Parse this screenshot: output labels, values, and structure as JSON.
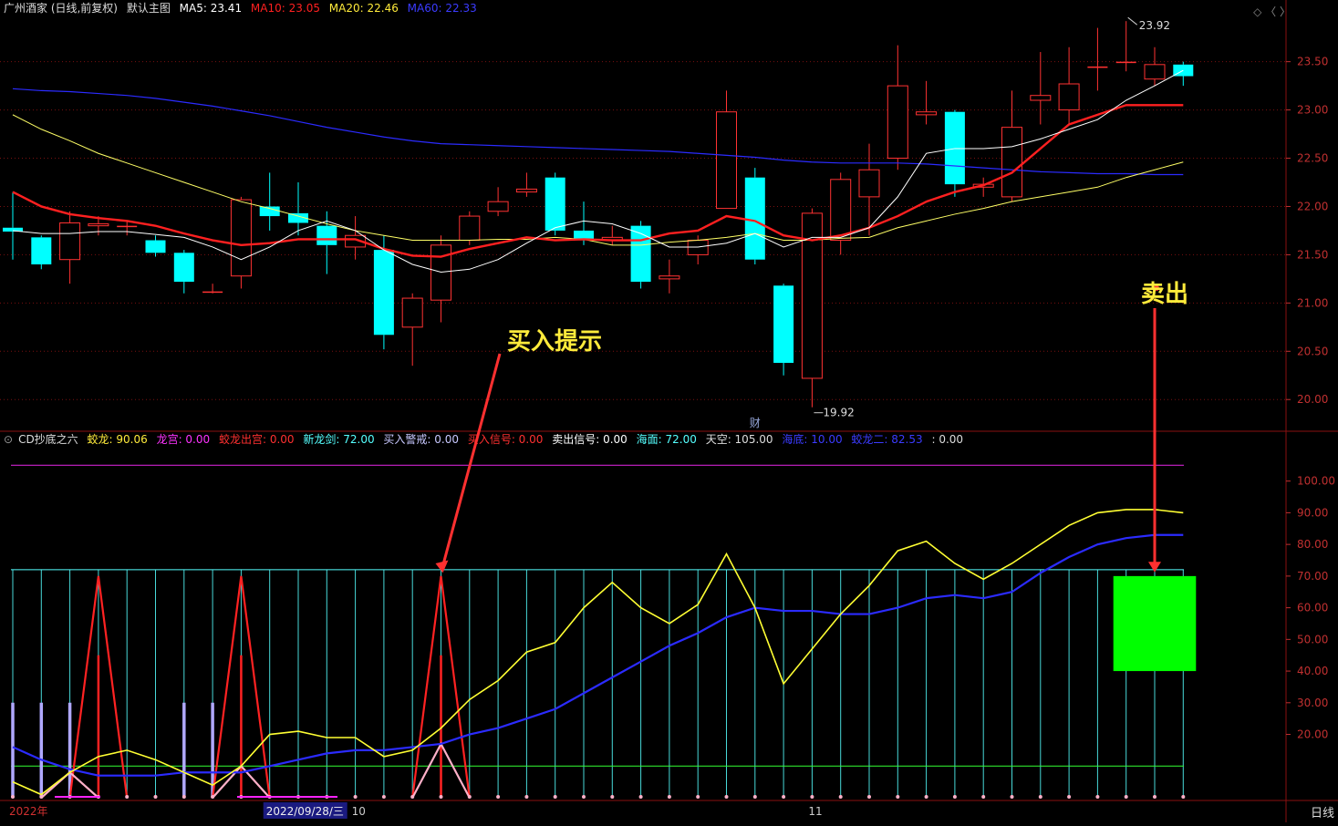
{
  "header": {
    "stock": "广州酒家 (日线,前复权)",
    "chart_name": "默认主图",
    "ma": [
      {
        "label": "MA5: 23.41",
        "color": "#ffffff"
      },
      {
        "label": "MA10: 23.05",
        "color": "#ff2020"
      },
      {
        "label": "MA20: 22.46",
        "color": "#ffeb3b"
      },
      {
        "label": "MA60: 22.33",
        "color": "#3b3bff"
      }
    ]
  },
  "indicator_header": {
    "name": "CD抄底之六",
    "items": [
      {
        "label": "蛟龙: 90.06",
        "color": "#ffeb3b"
      },
      {
        "label": "龙宫: 0.00",
        "color": "#ff33ff"
      },
      {
        "label": "蛟龙出宫: 0.00",
        "color": "#ff3030"
      },
      {
        "label": "新龙剑: 72.00",
        "color": "#55ffff"
      },
      {
        "label": "买入警戒: 0.00",
        "color": "#c8c8ff"
      },
      {
        "label": "买入信号: 0.00",
        "color": "#ff3030"
      },
      {
        "label": "卖出信号: 0.00",
        "color": "#ffffff"
      },
      {
        "label": "海面: 72.00",
        "color": "#55ffff"
      },
      {
        "label": "天空: 105.00",
        "color": "#dddddd"
      },
      {
        "label": "海底: 10.00",
        "color": "#3b3bff"
      },
      {
        "label": "蛟龙二: 82.53",
        "color": "#3b3bff"
      },
      {
        "label": ": 0.00",
        "color": "#dddddd"
      }
    ]
  },
  "annotations": {
    "buy": "买入提示",
    "sell": "卖出",
    "fin_marker": "财"
  },
  "timeframe": "日线",
  "colors": {
    "up": "#ff3232",
    "down": "#00ffff",
    "ma5": "#ffffff",
    "ma10": "#ff2020",
    "ma20": "#ffff66",
    "ma60": "#2b2bff",
    "grid": "#7a1010",
    "axis_text": "#c03030"
  },
  "chart_data": [
    {
      "type": "candlestick",
      "ylim": [
        19.7,
        23.95
      ],
      "yticks": [
        20.0,
        20.5,
        21.0,
        21.5,
        22.0,
        22.5,
        23.0,
        23.5
      ],
      "high_label": "23.92",
      "low_label": "19.92",
      "candles": [
        {
          "o": 21.78,
          "c": 21.74,
          "h": 22.15,
          "l": 21.45
        },
        {
          "o": 21.68,
          "c": 21.4,
          "h": 21.7,
          "l": 21.35
        },
        {
          "o": 21.45,
          "c": 21.83,
          "h": 21.95,
          "l": 21.2
        },
        {
          "o": 21.8,
          "c": 21.82,
          "h": 21.9,
          "l": 21.7
        },
        {
          "o": 21.8,
          "c": 21.8,
          "h": 21.85,
          "l": 21.7
        },
        {
          "o": 21.65,
          "c": 21.52,
          "h": 21.7,
          "l": 21.48
        },
        {
          "o": 21.52,
          "c": 21.22,
          "h": 21.55,
          "l": 21.1
        },
        {
          "o": 21.12,
          "c": 21.12,
          "h": 21.2,
          "l": 21.1
        },
        {
          "o": 21.28,
          "c": 22.07,
          "h": 22.1,
          "l": 21.15
        },
        {
          "o": 22.0,
          "c": 21.9,
          "h": 22.35,
          "l": 21.75
        },
        {
          "o": 21.93,
          "c": 21.83,
          "h": 22.25,
          "l": 21.7
        },
        {
          "o": 21.8,
          "c": 21.6,
          "h": 21.95,
          "l": 21.3
        },
        {
          "o": 21.58,
          "c": 21.7,
          "h": 21.9,
          "l": 21.45
        },
        {
          "o": 21.55,
          "c": 20.67,
          "h": 21.7,
          "l": 20.52
        },
        {
          "o": 20.75,
          "c": 21.05,
          "h": 21.1,
          "l": 20.35
        },
        {
          "o": 21.03,
          "c": 21.6,
          "h": 21.7,
          "l": 20.8
        },
        {
          "o": 21.65,
          "c": 21.9,
          "h": 21.95,
          "l": 21.6
        },
        {
          "o": 21.95,
          "c": 22.05,
          "h": 22.2,
          "l": 21.9
        },
        {
          "o": 22.15,
          "c": 22.18,
          "h": 22.35,
          "l": 22.1
        },
        {
          "o": 22.3,
          "c": 21.75,
          "h": 22.35,
          "l": 21.7
        },
        {
          "o": 21.75,
          "c": 21.65,
          "h": 22.05,
          "l": 21.6
        },
        {
          "o": 21.65,
          "c": 21.68,
          "h": 21.8,
          "l": 21.6
        },
        {
          "o": 21.8,
          "c": 21.22,
          "h": 21.85,
          "l": 21.15
        },
        {
          "o": 21.25,
          "c": 21.28,
          "h": 21.45,
          "l": 21.1
        },
        {
          "o": 21.5,
          "c": 21.65,
          "h": 21.7,
          "l": 21.4
        },
        {
          "o": 21.98,
          "c": 22.98,
          "h": 23.2,
          "l": 21.98
        },
        {
          "o": 22.3,
          "c": 21.45,
          "h": 22.4,
          "l": 21.4
        },
        {
          "o": 21.18,
          "c": 20.38,
          "h": 21.2,
          "l": 20.25
        },
        {
          "o": 20.22,
          "c": 21.93,
          "h": 21.98,
          "l": 19.92
        },
        {
          "o": 21.65,
          "c": 22.28,
          "h": 22.35,
          "l": 21.5
        },
        {
          "o": 22.1,
          "c": 22.38,
          "h": 22.65,
          "l": 21.7
        },
        {
          "o": 22.5,
          "c": 23.25,
          "h": 23.67,
          "l": 22.38
        },
        {
          "o": 22.95,
          "c": 22.98,
          "h": 23.3,
          "l": 22.85
        },
        {
          "o": 22.98,
          "c": 22.23,
          "h": 23.0,
          "l": 22.1
        },
        {
          "o": 22.2,
          "c": 22.23,
          "h": 22.3,
          "l": 22.1
        },
        {
          "o": 22.1,
          "c": 22.82,
          "h": 23.2,
          "l": 22.05
        },
        {
          "o": 23.1,
          "c": 23.15,
          "h": 23.6,
          "l": 22.85
        },
        {
          "o": 23.0,
          "c": 23.27,
          "h": 23.65,
          "l": 22.85
        },
        {
          "o": 23.45,
          "c": 23.45,
          "h": 23.85,
          "l": 23.2
        },
        {
          "o": 23.5,
          "c": 23.5,
          "h": 23.92,
          "l": 23.4
        },
        {
          "o": 23.32,
          "c": 23.47,
          "h": 23.65,
          "l": 23.25
        },
        {
          "o": 23.47,
          "c": 23.35,
          "h": 23.5,
          "l": 23.25
        }
      ],
      "ma5": [
        21.75,
        21.72,
        21.72,
        21.74,
        21.74,
        21.71,
        21.68,
        21.58,
        21.45,
        21.58,
        21.75,
        21.85,
        21.75,
        21.55,
        21.4,
        21.32,
        21.35,
        21.45,
        21.62,
        21.78,
        21.85,
        21.82,
        21.72,
        21.58,
        21.58,
        21.62,
        21.72,
        21.58,
        21.68,
        21.68,
        21.78,
        22.1,
        22.55,
        22.6,
        22.6,
        22.62,
        22.7,
        22.8,
        22.9,
        23.1,
        23.25,
        23.41
      ],
      "ma10": [
        22.15,
        22.0,
        21.92,
        21.88,
        21.85,
        21.8,
        21.72,
        21.65,
        21.6,
        21.62,
        21.66,
        21.66,
        21.66,
        21.56,
        21.49,
        21.48,
        21.56,
        21.62,
        21.68,
        21.65,
        21.66,
        21.65,
        21.65,
        21.72,
        21.75,
        21.9,
        21.85,
        21.7,
        21.65,
        21.7,
        21.78,
        21.9,
        22.05,
        22.15,
        22.22,
        22.35,
        22.6,
        22.85,
        22.95,
        23.05,
        23.05,
        23.05
      ],
      "ma20": [
        22.95,
        22.8,
        22.68,
        22.55,
        22.45,
        22.35,
        22.25,
        22.15,
        22.05,
        21.98,
        21.9,
        21.82,
        21.75,
        21.7,
        21.65,
        21.65,
        21.65,
        21.66,
        21.66,
        21.68,
        21.66,
        21.6,
        21.6,
        21.63,
        21.65,
        21.68,
        21.72,
        21.65,
        21.65,
        21.67,
        21.68,
        21.78,
        21.85,
        21.92,
        21.98,
        22.05,
        22.1,
        22.15,
        22.2,
        22.3,
        22.38,
        22.46
      ],
      "ma60": [
        23.22,
        23.2,
        23.19,
        23.17,
        23.15,
        23.12,
        23.08,
        23.04,
        22.99,
        22.94,
        22.88,
        22.82,
        22.77,
        22.72,
        22.68,
        22.65,
        22.64,
        22.63,
        22.62,
        22.61,
        22.6,
        22.59,
        22.58,
        22.57,
        22.55,
        22.53,
        22.51,
        22.48,
        22.46,
        22.45,
        22.45,
        22.45,
        22.44,
        22.42,
        22.4,
        22.38,
        22.36,
        22.35,
        22.34,
        22.34,
        22.33,
        22.33
      ]
    },
    {
      "type": "line",
      "title": "CD抄底之六",
      "ylim": [
        0,
        112
      ],
      "yticks": [
        20,
        30,
        40,
        50,
        60,
        70,
        80,
        90,
        100
      ],
      "tick_labels": [
        "20.00",
        "30.00",
        "40.00",
        "50.00",
        "60.00",
        "70.00",
        "80.00",
        "90.00",
        "100.00"
      ],
      "x_labels": [
        {
          "label": "2022年",
          "index": 0
        },
        {
          "label": "2022/09/28/三",
          "index": 9
        },
        {
          "label": "10",
          "index": 12
        },
        {
          "label": "11",
          "index": 28
        }
      ],
      "series": [
        {
          "name": "蛟龙",
          "color": "#ffff33",
          "values": [
            5,
            1,
            8,
            13,
            15,
            12,
            8,
            4,
            10,
            20,
            21,
            19,
            19,
            13,
            15,
            22,
            31,
            37,
            46,
            49,
            60,
            68,
            60,
            55,
            61,
            77,
            60,
            36,
            47,
            58,
            67,
            78,
            81,
            74,
            69,
            74,
            80,
            86,
            90,
            91,
            91,
            90
          ]
        },
        {
          "name": "蛟龙二",
          "color": "#2b2bff",
          "values": [
            16,
            12,
            9,
            7,
            7,
            7,
            8,
            8,
            8,
            10,
            12,
            14,
            15,
            15,
            16,
            17,
            20,
            22,
            25,
            28,
            33,
            38,
            43,
            48,
            52,
            57,
            60,
            59,
            59,
            58,
            58,
            60,
            63,
            64,
            63,
            65,
            71,
            76,
            80,
            82,
            83,
            83
          ]
        },
        {
          "name": "海面",
          "color": "#55ffff",
          "values": [
            72
          ]
        },
        {
          "name": "海底",
          "color": "#33ff33",
          "values": [
            10
          ]
        },
        {
          "name": "天空",
          "color": "#cc22cc",
          "values": [
            105
          ]
        },
        {
          "name": "买入信号",
          "color": "#ff2222",
          "spikes": [
            {
              "i": 3,
              "v": 70
            },
            {
              "i": 8,
              "v": 70
            },
            {
              "i": 15,
              "v": 70
            }
          ]
        },
        {
          "name": "蛟龙出宫",
          "color": "#ffb0c8",
          "spikes": [
            {
              "i": 2,
              "v": 8
            },
            {
              "i": 8,
              "v": 10
            },
            {
              "i": 15,
              "v": 17
            }
          ]
        },
        {
          "name": "买入警戒",
          "color": "#b0a8ff",
          "bars": [
            0,
            1,
            2,
            6,
            7
          ]
        },
        {
          "name": "卖出信号",
          "color": "#00ff00",
          "box": {
            "from": 39,
            "to": 41,
            "top": 70,
            "bottom": 40
          }
        }
      ]
    }
  ]
}
